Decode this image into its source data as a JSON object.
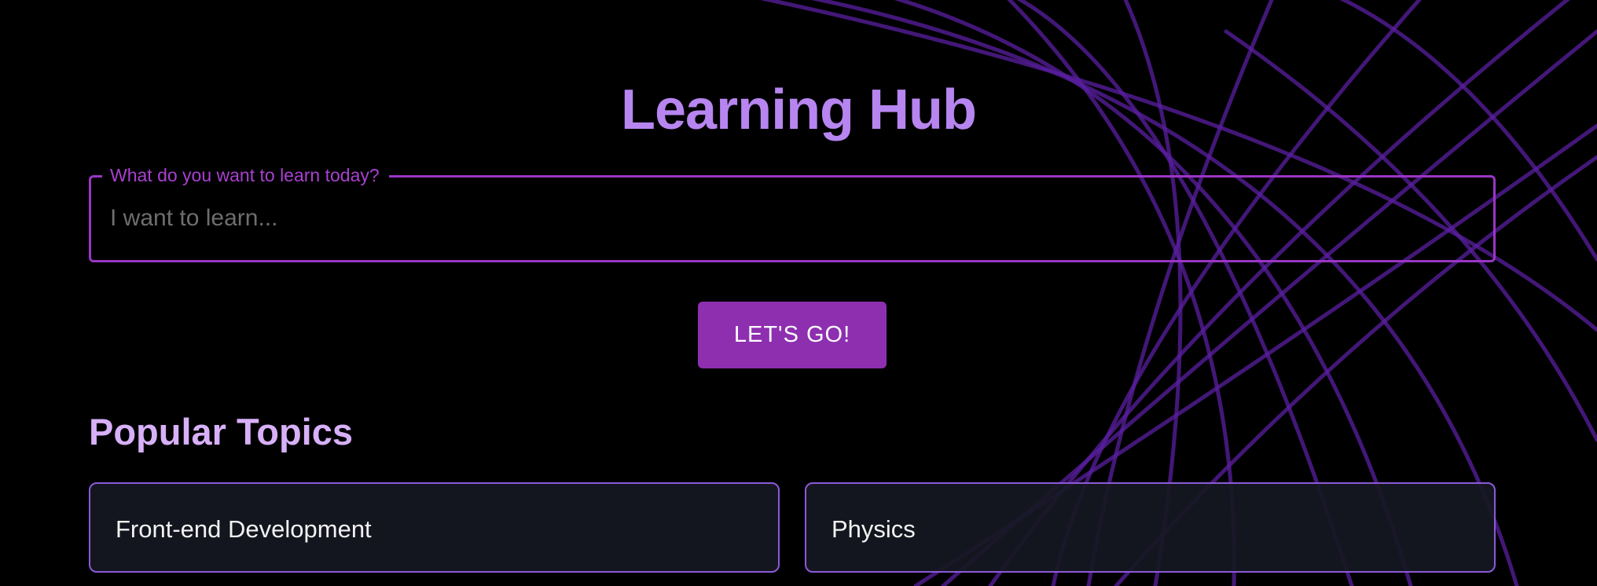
{
  "app": {
    "title": "Learning Hub"
  },
  "search": {
    "legend": "What do you want to learn today?",
    "placeholder": "I want to learn...",
    "value": ""
  },
  "actions": {
    "go_label": "LET'S GO!"
  },
  "popular": {
    "heading": "Popular Topics",
    "topics": [
      {
        "label": "Front-end Development"
      },
      {
        "label": "Physics"
      }
    ]
  },
  "colors": {
    "background": "#000000",
    "title": "#b785f0",
    "accent": "#8e2fb0",
    "field_border": "#9a36c4",
    "section_title": "#d7b0f8",
    "card_border": "#8b5ad8",
    "card_background": "#161822",
    "decor_lines": "#5a1fa0"
  }
}
